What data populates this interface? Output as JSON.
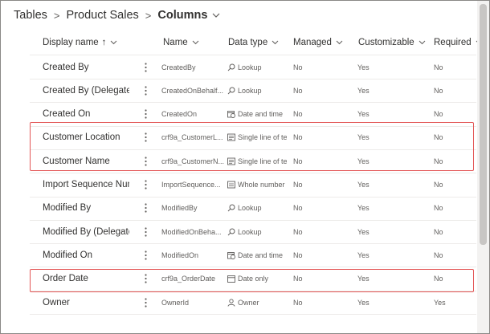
{
  "breadcrumb": {
    "items": [
      "Tables",
      "Product Sales"
    ],
    "current": "Columns",
    "separator": ">"
  },
  "columns": {
    "display_name": "Display name",
    "display_sort": "↑",
    "name": "Name",
    "data_type": "Data type",
    "managed": "Managed",
    "customizable": "Customizable",
    "required": "Required"
  },
  "rows": [
    {
      "display": "Created By",
      "name": "CreatedBy",
      "type": "Lookup",
      "type_icon": "search-icon",
      "managed": "No",
      "custom": "Yes",
      "required": "No"
    },
    {
      "display": "Created By (Delegate)",
      "name": "CreatedOnBehalf...",
      "type": "Lookup",
      "type_icon": "search-icon",
      "managed": "No",
      "custom": "Yes",
      "required": "No"
    },
    {
      "display": "Created On",
      "name": "CreatedOn",
      "type": "Date and time",
      "type_icon": "calendar-clock-icon",
      "managed": "No",
      "custom": "Yes",
      "required": "No"
    },
    {
      "display": "Customer Location",
      "name": "crf9a_CustomerL...",
      "type": "Single line of te",
      "type_icon": "text-lines-icon",
      "managed": "No",
      "custom": "Yes",
      "required": "No"
    },
    {
      "display": "Customer Name",
      "name": "crf9a_CustomerN...",
      "type": "Single line of te",
      "type_icon": "text-lines-icon",
      "managed": "No",
      "custom": "Yes",
      "required": "No"
    },
    {
      "display": "Import Sequence Number",
      "name": "ImportSequence...",
      "type": "Whole number",
      "type_icon": "number-icon",
      "managed": "No",
      "custom": "Yes",
      "required": "No"
    },
    {
      "display": "Modified By",
      "name": "ModifiedBy",
      "type": "Lookup",
      "type_icon": "search-icon",
      "managed": "No",
      "custom": "Yes",
      "required": "No"
    },
    {
      "display": "Modified By (Delegate)",
      "name": "ModifiedOnBeha...",
      "type": "Lookup",
      "type_icon": "search-icon",
      "managed": "No",
      "custom": "Yes",
      "required": "No"
    },
    {
      "display": "Modified On",
      "name": "ModifiedOn",
      "type": "Date and time",
      "type_icon": "calendar-clock-icon",
      "managed": "No",
      "custom": "Yes",
      "required": "No"
    },
    {
      "display": "Order Date",
      "name": "crf9a_OrderDate",
      "type": "Date only",
      "type_icon": "calendar-icon",
      "managed": "No",
      "custom": "Yes",
      "required": "No"
    },
    {
      "display": "Owner",
      "name": "OwnerId",
      "type": "Owner",
      "type_icon": "person-icon",
      "managed": "No",
      "custom": "Yes",
      "required": "Yes"
    }
  ],
  "highlight_color": "#e35454"
}
